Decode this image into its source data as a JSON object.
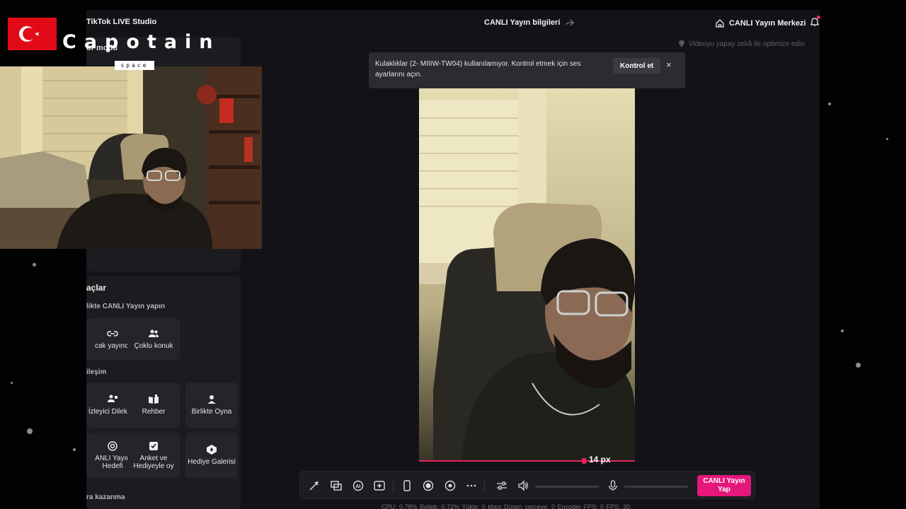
{
  "app": {
    "title": "TikTok LIVE Studio",
    "center_title": "CANLI Yayın bilgileri",
    "center_icon": "share-icon",
    "right_title": "CANLI Yayın Merkezi",
    "right_icon": "home-icon",
    "bell_icon": "bell-icon",
    "optimize_hint": "Videoyu yapay zekâ ile optimize edin"
  },
  "left_top_panel": {
    "title": "ör modu"
  },
  "tools_panel": {
    "title": "açlar",
    "sections": [
      {
        "label": "likte CANLI Yayın yapın",
        "items": [
          {
            "label": "cak yayıncı",
            "icon": "link-icon"
          },
          {
            "label": "Çoklu konuk",
            "icon": "users-icon"
          }
        ]
      },
      {
        "label": "ileşim",
        "items": [
          {
            "label": "İzleyici Dilekleri",
            "icon": "viewer-requests-icon"
          },
          {
            "label": "Rehber",
            "icon": "guide-icon"
          },
          {
            "label": "Birlikte Oyna",
            "icon": "play-together-icon"
          }
        ]
      },
      {
        "label": "",
        "items": [
          {
            "label": "ANLI Yayın Hedefi",
            "icon": "target-icon"
          },
          {
            "label": "Anket ve Hediyeyle oy",
            "icon": "poll-icon"
          },
          {
            "label": "Hediye Galerisi",
            "icon": "gift-gallery-icon"
          }
        ]
      },
      {
        "label": "ra kazanma",
        "items": []
      }
    ]
  },
  "toast": {
    "message": "Kulaklıklar (2- MIIIW-TW04) kullanılamıyor. Kontrol etmek için ses ayarlarını açın.",
    "action_label": "Kontrol et",
    "close_label": "×"
  },
  "preview": {
    "px_label": "14 px"
  },
  "toolbar": {
    "icons": [
      "magic-wand-icon",
      "layers-icon",
      "ai-effects-icon",
      "add-source-icon",
      "phone-icon",
      "record-icon",
      "camera-effects-icon",
      "more-icon",
      "settings-sliders-icon",
      "speaker-icon",
      "microphone-icon"
    ],
    "go_live_label": "CANLI Yayın Yap"
  },
  "stats": {
    "text": "CPU: 0.78%   Bellek: 0.72%   Yükle: 0 kbps   Düşen çerçeve: 0   Encoder FPS: 0   FPS: 30"
  },
  "overlay": {
    "brand": "Capotain",
    "brand_sub": "space",
    "flag": "turkey-flag"
  },
  "colors": {
    "accent": "#e5177b",
    "progress": "#e8245a",
    "background": "#131317",
    "panel": "#1b1b20"
  }
}
